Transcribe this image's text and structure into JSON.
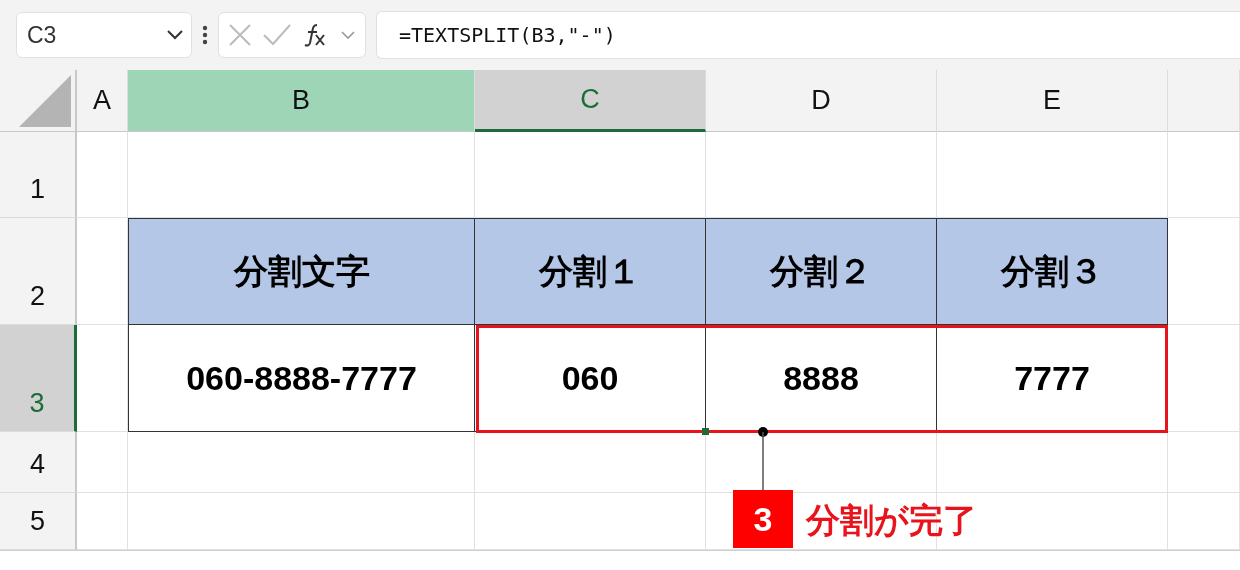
{
  "name_box": {
    "value": "C3"
  },
  "formula_bar": {
    "formula": "=TEXTSPLIT(B3,\"-\")"
  },
  "columns": [
    {
      "label": "A",
      "selected": false,
      "highlighted": false
    },
    {
      "label": "B",
      "selected": false,
      "highlighted": true
    },
    {
      "label": "C",
      "selected": true,
      "highlighted": false
    },
    {
      "label": "D",
      "selected": false,
      "highlighted": false
    },
    {
      "label": "E",
      "selected": false,
      "highlighted": false
    }
  ],
  "rows": [
    {
      "label": "1",
      "selected": false
    },
    {
      "label": "2",
      "selected": false
    },
    {
      "label": "3",
      "selected": true
    },
    {
      "label": "4",
      "selected": false
    },
    {
      "label": "5",
      "selected": false
    }
  ],
  "table": {
    "header": [
      "分割文字",
      "分割１",
      "分割２",
      "分割３"
    ],
    "values": [
      "060-8888-7777",
      "060",
      "8888",
      "7777"
    ]
  },
  "callout": {
    "number": "3",
    "text": "分割が完了"
  }
}
